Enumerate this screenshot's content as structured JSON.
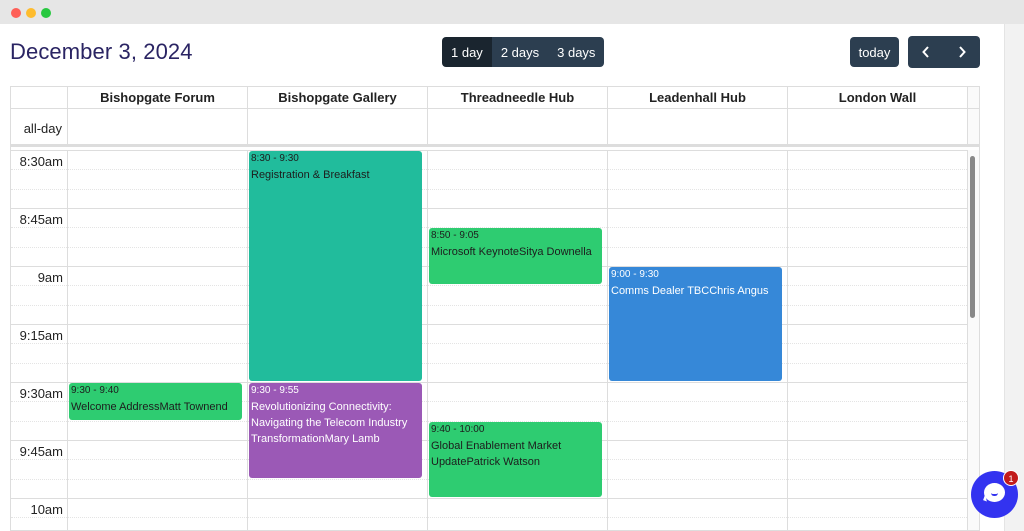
{
  "window": {
    "controls": [
      "close",
      "minimize",
      "maximize"
    ]
  },
  "header": {
    "title": "December 3, 2024",
    "views": [
      {
        "label": "1 day",
        "active": true
      },
      {
        "label": "2 days",
        "active": false
      },
      {
        "label": "3 days",
        "active": false
      }
    ],
    "today_label": "today",
    "prev_icon": "‹",
    "next_icon": "›"
  },
  "calendar": {
    "allday_label": "all-day",
    "resources": [
      "Bishopgate Forum",
      "Bishopgate Gallery",
      "Threadneedle Hub",
      "Leadenhall Hub",
      "London Wall"
    ],
    "time_labels": [
      "8:30am",
      "8:45am",
      "9am",
      "9:15am",
      "9:30am",
      "9:45am",
      "10am"
    ],
    "events": [
      {
        "resource": 1,
        "time": "8:30 - 9:30",
        "title": "Registration & Breakfast",
        "start_min": 0,
        "end_min": 60,
        "color": "#21bc9c",
        "text_color": "#1d1d1d"
      },
      {
        "resource": 2,
        "time": "8:50 - 9:05",
        "title": "Microsoft KeynoteSitya Downella",
        "start_min": 20,
        "end_min": 35,
        "color": "#2ecc71",
        "text_color": "#1d1d1d"
      },
      {
        "resource": 3,
        "time": "9:00 - 9:30",
        "title": "Comms Dealer TBCChris Angus",
        "start_min": 30,
        "end_min": 60,
        "color": "#3688d8",
        "text_color": "#ffffff"
      },
      {
        "resource": 0,
        "time": "9:30 - 9:40",
        "title": "Welcome AddressMatt Townend",
        "start_min": 60,
        "end_min": 70,
        "color": "#2ecc71",
        "text_color": "#1d1d1d"
      },
      {
        "resource": 1,
        "time": "9:30 - 9:55",
        "title": "Revolutionizing Connectivity: Navigating the Telecom Industry TransformationMary Lamb",
        "start_min": 60,
        "end_min": 85,
        "color": "#9b59b6",
        "text_color": "#ffffff"
      },
      {
        "resource": 2,
        "time": "9:40 - 10:00",
        "title": "Global Enablement Market UpdatePatrick Watson",
        "start_min": 70,
        "end_min": 90,
        "color": "#2ecc71",
        "text_color": "#1d1d1d"
      }
    ]
  },
  "chat": {
    "icon": "chat-bubble-icon",
    "badge": "1"
  }
}
